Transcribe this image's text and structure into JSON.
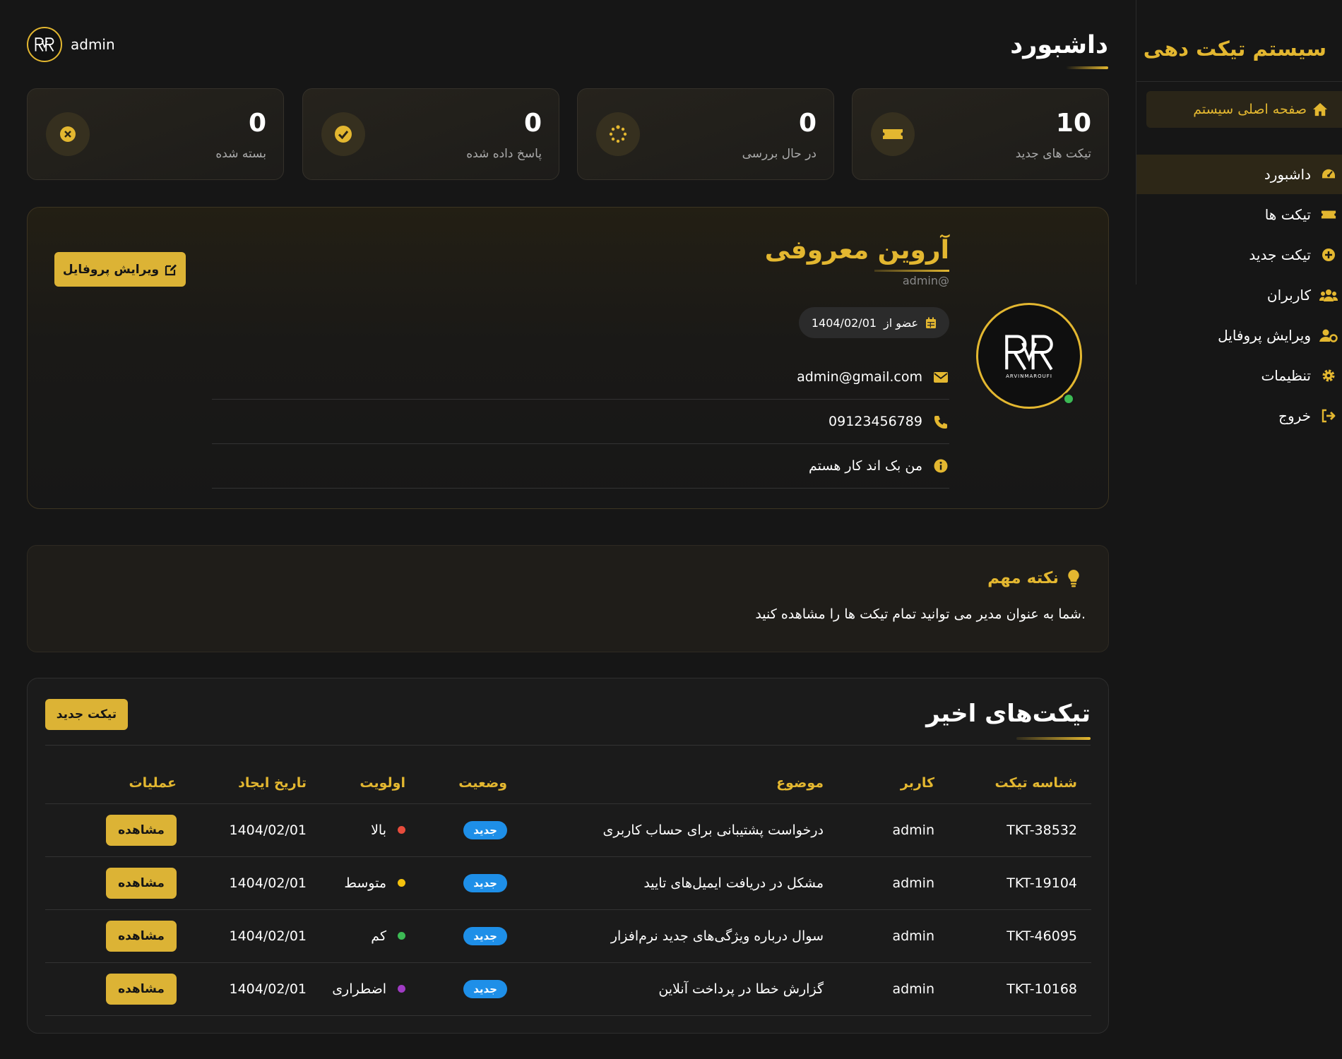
{
  "sidebar": {
    "brand": "سیستم تیکت دهی",
    "home_label": "صفحه اصلی سیستم",
    "items": [
      {
        "label": "داشبورد",
        "icon": "dashboard-gauge-icon",
        "active": true
      },
      {
        "label": "تیکت ها",
        "icon": "ticket-icon",
        "active": false
      },
      {
        "label": "تیکت جدید",
        "icon": "plus-circle-icon",
        "active": false
      },
      {
        "label": "کاربران",
        "icon": "users-icon",
        "active": false
      },
      {
        "label": "ویرایش پروفایل",
        "icon": "user-cog-icon",
        "active": false
      },
      {
        "label": "تنظیمات",
        "icon": "gear-icon",
        "active": false
      },
      {
        "label": "خروج",
        "icon": "sign-out-icon",
        "active": false
      }
    ]
  },
  "header": {
    "title": "داشبورد",
    "username": "admin"
  },
  "stats": [
    {
      "value": "10",
      "label": "تیکت های جدید",
      "icon": "ticket-icon"
    },
    {
      "value": "0",
      "label": "در حال بررسی",
      "icon": "spinner-icon"
    },
    {
      "value": "0",
      "label": "پاسخ داده شده",
      "icon": "check-circle-icon"
    },
    {
      "value": "0",
      "label": "بسته شده",
      "icon": "x-circle-icon"
    }
  ],
  "profile": {
    "name": "آروین معروفی",
    "handle": "admin@",
    "avatar_tag": "ARVINMAROUFI",
    "member_since_label": "عضو از",
    "member_since": "1404/02/01",
    "email": "admin@gmail.com",
    "phone": "09123456789",
    "bio": "من بک اند کار هستم",
    "edit_button": "ویرایش پروفایل"
  },
  "note": {
    "title": "نکته مهم",
    "text": "شما به عنوان مدیر می توانید تمام تیکت ها را مشاهده کنید."
  },
  "tickets": {
    "title": "تیکت‌های اخیر",
    "new_button": "تیکت جدید",
    "columns": {
      "id": "شناسه تیکت",
      "user": "کاربر",
      "subject": "موضوع",
      "status": "وضعیت",
      "priority": "اولویت",
      "date": "تاریخ ایجاد",
      "actions": "عملیات"
    },
    "rows": [
      {
        "id": "TKT-38532",
        "user": "admin",
        "subject": "درخواست پشتیبانی برای حساب کاربری",
        "status": "جدید",
        "priority": "بالا",
        "priority_color": "#e74c3c",
        "date": "1404/02/01",
        "action": "مشاهده"
      },
      {
        "id": "TKT-19104",
        "user": "admin",
        "subject": "مشکل در دریافت ایمیل‌های تایید",
        "status": "جدید",
        "priority": "متوسط",
        "priority_color": "#f4c20d",
        "date": "1404/02/01",
        "action": "مشاهده"
      },
      {
        "id": "TKT-46095",
        "user": "admin",
        "subject": "سوال درباره ویژگی‌های جدید نرم‌افزار",
        "status": "جدید",
        "priority": "کم",
        "priority_color": "#3cba54",
        "date": "1404/02/01",
        "action": "مشاهده"
      },
      {
        "id": "TKT-10168",
        "user": "admin",
        "subject": "گزارش خطا در پرداخت آنلاین",
        "status": "جدید",
        "priority": "اضطراری",
        "priority_color": "#a03bc4",
        "date": "1404/02/01",
        "action": "مشاهده"
      }
    ]
  },
  "colors": {
    "accent": "#e3b730",
    "background": "#161616",
    "badge_blue": "#1e8fe8",
    "online": "#3cba54"
  }
}
